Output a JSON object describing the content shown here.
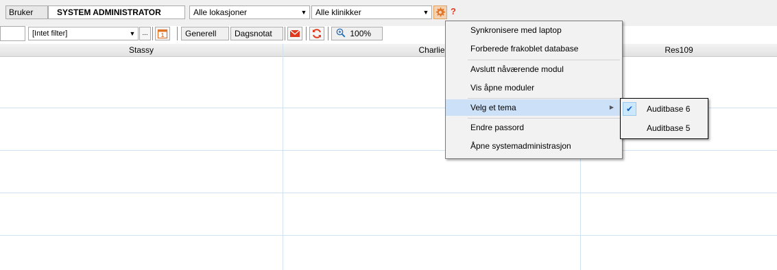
{
  "toolbar": {
    "user_label": "Bruker",
    "user_name": "SYSTEM ADMINISTRATOR",
    "location_select": "Alle lokasjoner",
    "clinic_select": "Alle klinikker",
    "help_label": "?",
    "filter_select": "[Intet filter]",
    "ellipsis_label": "...",
    "general_label": "Generell",
    "dagsnotat_label": "Dagsnotat",
    "zoom_label": "100%"
  },
  "columns": {
    "headers": [
      "Stassy",
      "Charlie",
      "Res109"
    ]
  },
  "menu": {
    "items": [
      "Synkronisere med laptop",
      "Forberede frakoblet database",
      "Avslutt nåværende modul",
      "Vis åpne moduler",
      "Velg et tema",
      "Endre passord",
      "Åpne systemadministrasjon"
    ]
  },
  "theme_submenu": {
    "items": [
      "Auditbase 6",
      "Auditbase 5"
    ],
    "selected": "Auditbase 6"
  },
  "colors": {
    "grid_line": "#cfe2f3",
    "menu_highlight": "#cce0f7",
    "accent_orange": "#e0762a",
    "help_red": "#e03a1e"
  }
}
